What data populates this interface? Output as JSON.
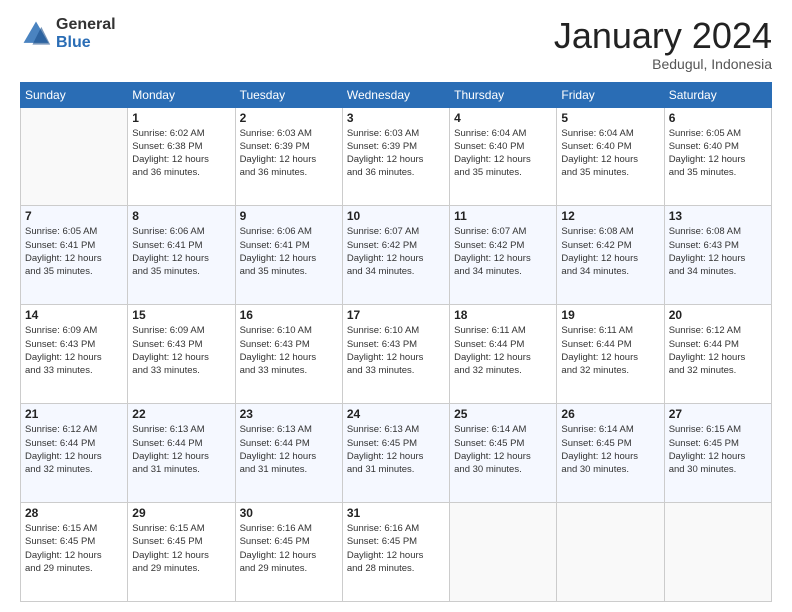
{
  "header": {
    "logo_general": "General",
    "logo_blue": "Blue",
    "month_year": "January 2024",
    "location": "Bedugul, Indonesia"
  },
  "days_of_week": [
    "Sunday",
    "Monday",
    "Tuesday",
    "Wednesday",
    "Thursday",
    "Friday",
    "Saturday"
  ],
  "weeks": [
    [
      {
        "day": "",
        "content": ""
      },
      {
        "day": "1",
        "content": "Sunrise: 6:02 AM\nSunset: 6:38 PM\nDaylight: 12 hours\nand 36 minutes."
      },
      {
        "day": "2",
        "content": "Sunrise: 6:03 AM\nSunset: 6:39 PM\nDaylight: 12 hours\nand 36 minutes."
      },
      {
        "day": "3",
        "content": "Sunrise: 6:03 AM\nSunset: 6:39 PM\nDaylight: 12 hours\nand 36 minutes."
      },
      {
        "day": "4",
        "content": "Sunrise: 6:04 AM\nSunset: 6:40 PM\nDaylight: 12 hours\nand 35 minutes."
      },
      {
        "day": "5",
        "content": "Sunrise: 6:04 AM\nSunset: 6:40 PM\nDaylight: 12 hours\nand 35 minutes."
      },
      {
        "day": "6",
        "content": "Sunrise: 6:05 AM\nSunset: 6:40 PM\nDaylight: 12 hours\nand 35 minutes."
      }
    ],
    [
      {
        "day": "7",
        "content": "Sunrise: 6:05 AM\nSunset: 6:41 PM\nDaylight: 12 hours\nand 35 minutes."
      },
      {
        "day": "8",
        "content": "Sunrise: 6:06 AM\nSunset: 6:41 PM\nDaylight: 12 hours\nand 35 minutes."
      },
      {
        "day": "9",
        "content": "Sunrise: 6:06 AM\nSunset: 6:41 PM\nDaylight: 12 hours\nand 35 minutes."
      },
      {
        "day": "10",
        "content": "Sunrise: 6:07 AM\nSunset: 6:42 PM\nDaylight: 12 hours\nand 34 minutes."
      },
      {
        "day": "11",
        "content": "Sunrise: 6:07 AM\nSunset: 6:42 PM\nDaylight: 12 hours\nand 34 minutes."
      },
      {
        "day": "12",
        "content": "Sunrise: 6:08 AM\nSunset: 6:42 PM\nDaylight: 12 hours\nand 34 minutes."
      },
      {
        "day": "13",
        "content": "Sunrise: 6:08 AM\nSunset: 6:43 PM\nDaylight: 12 hours\nand 34 minutes."
      }
    ],
    [
      {
        "day": "14",
        "content": "Sunrise: 6:09 AM\nSunset: 6:43 PM\nDaylight: 12 hours\nand 33 minutes."
      },
      {
        "day": "15",
        "content": "Sunrise: 6:09 AM\nSunset: 6:43 PM\nDaylight: 12 hours\nand 33 minutes."
      },
      {
        "day": "16",
        "content": "Sunrise: 6:10 AM\nSunset: 6:43 PM\nDaylight: 12 hours\nand 33 minutes."
      },
      {
        "day": "17",
        "content": "Sunrise: 6:10 AM\nSunset: 6:43 PM\nDaylight: 12 hours\nand 33 minutes."
      },
      {
        "day": "18",
        "content": "Sunrise: 6:11 AM\nSunset: 6:44 PM\nDaylight: 12 hours\nand 32 minutes."
      },
      {
        "day": "19",
        "content": "Sunrise: 6:11 AM\nSunset: 6:44 PM\nDaylight: 12 hours\nand 32 minutes."
      },
      {
        "day": "20",
        "content": "Sunrise: 6:12 AM\nSunset: 6:44 PM\nDaylight: 12 hours\nand 32 minutes."
      }
    ],
    [
      {
        "day": "21",
        "content": "Sunrise: 6:12 AM\nSunset: 6:44 PM\nDaylight: 12 hours\nand 32 minutes."
      },
      {
        "day": "22",
        "content": "Sunrise: 6:13 AM\nSunset: 6:44 PM\nDaylight: 12 hours\nand 31 minutes."
      },
      {
        "day": "23",
        "content": "Sunrise: 6:13 AM\nSunset: 6:44 PM\nDaylight: 12 hours\nand 31 minutes."
      },
      {
        "day": "24",
        "content": "Sunrise: 6:13 AM\nSunset: 6:45 PM\nDaylight: 12 hours\nand 31 minutes."
      },
      {
        "day": "25",
        "content": "Sunrise: 6:14 AM\nSunset: 6:45 PM\nDaylight: 12 hours\nand 30 minutes."
      },
      {
        "day": "26",
        "content": "Sunrise: 6:14 AM\nSunset: 6:45 PM\nDaylight: 12 hours\nand 30 minutes."
      },
      {
        "day": "27",
        "content": "Sunrise: 6:15 AM\nSunset: 6:45 PM\nDaylight: 12 hours\nand 30 minutes."
      }
    ],
    [
      {
        "day": "28",
        "content": "Sunrise: 6:15 AM\nSunset: 6:45 PM\nDaylight: 12 hours\nand 29 minutes."
      },
      {
        "day": "29",
        "content": "Sunrise: 6:15 AM\nSunset: 6:45 PM\nDaylight: 12 hours\nand 29 minutes."
      },
      {
        "day": "30",
        "content": "Sunrise: 6:16 AM\nSunset: 6:45 PM\nDaylight: 12 hours\nand 29 minutes."
      },
      {
        "day": "31",
        "content": "Sunrise: 6:16 AM\nSunset: 6:45 PM\nDaylight: 12 hours\nand 28 minutes."
      },
      {
        "day": "",
        "content": ""
      },
      {
        "day": "",
        "content": ""
      },
      {
        "day": "",
        "content": ""
      }
    ]
  ]
}
